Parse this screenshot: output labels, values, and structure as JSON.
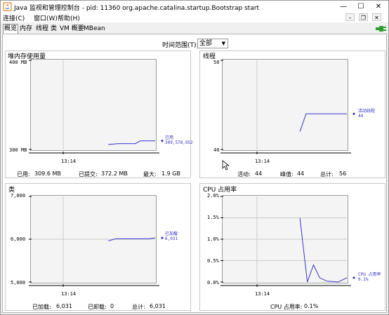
{
  "window": {
    "title": "Java 监视和管理控制台 - pid: 11360 org.apache.catalina.startup.Bootstrap start",
    "minimize": "—",
    "maximize": "☐",
    "close": "✕"
  },
  "menu": {
    "items": [
      "连接(C)",
      "窗口(W)",
      "帮助(H)"
    ]
  },
  "mdi_controls": [
    "–",
    "❐",
    "✕"
  ],
  "tabs": [
    "概览",
    "内存",
    "线程",
    "类",
    "VM 概要",
    "MBean"
  ],
  "time_range": {
    "label": "时间范围(T):",
    "value": "全部"
  },
  "colors": {
    "series": "#3333cc",
    "grid": "#cccccc",
    "connect_icon": "#2e9e2e"
  },
  "panels": {
    "heap": {
      "title": "堆内存使用量",
      "stats": [
        {
          "label": "已用:",
          "value": "309.6 MB"
        },
        {
          "label": "已提交:",
          "value": "372.2 MB"
        },
        {
          "label": "最大:",
          "value": "1.9 GB"
        }
      ]
    },
    "threads": {
      "title": "线程",
      "stats": [
        {
          "label": "活动:",
          "value": "44"
        },
        {
          "label": "峰值:",
          "value": "44"
        },
        {
          "label": "总计:",
          "value": "56"
        }
      ]
    },
    "classes": {
      "title": "类",
      "stats": [
        {
          "label": "已加载:",
          "value": "6,031"
        },
        {
          "label": "已卸载:",
          "value": "0"
        },
        {
          "label": "总计:",
          "value": "6,031"
        }
      ]
    },
    "cpu": {
      "title": "CPU 占用率",
      "stats": [
        {
          "label": "CPU 占用率:",
          "value": "0.1%"
        }
      ]
    }
  },
  "chart_data": [
    {
      "id": "heap",
      "type": "line",
      "ylim": [
        300,
        400
      ],
      "yticks": [
        "400 MB",
        "300 MB"
      ],
      "xticks": [
        "13:14"
      ],
      "x": [
        0.62,
        0.7,
        0.84,
        0.88,
        1.0
      ],
      "series": [
        {
          "name": "已用",
          "values": [
            305.5,
            306.5,
            306.5,
            309.6,
            309.6
          ],
          "latest": "309,578,952"
        }
      ]
    },
    {
      "id": "threads",
      "type": "line",
      "ylim": [
        40,
        50
      ],
      "yticks": [
        "50",
        "40"
      ],
      "xticks": [
        "13:14"
      ],
      "x": [
        0.62,
        0.67,
        1.0
      ],
      "series": [
        {
          "name": "活动线程",
          "values": [
            42,
            44,
            44
          ],
          "latest": "44"
        }
      ]
    },
    {
      "id": "classes",
      "type": "line",
      "ylim": [
        5000,
        7000
      ],
      "yticks": [
        "7,000",
        "6,000",
        "5,000"
      ],
      "xticks": [
        "13:14"
      ],
      "x": [
        0.62,
        0.68,
        0.95,
        1.0
      ],
      "series": [
        {
          "name": "已加载",
          "values": [
            5960,
            6010,
            6010,
            6031
          ],
          "latest": "6,031"
        }
      ]
    },
    {
      "id": "cpu",
      "type": "line",
      "ylim": [
        0,
        2.0
      ],
      "yticks": [
        "2.0%",
        "1.5%",
        "1.0%",
        "0.5%",
        "0.0%"
      ],
      "xticks": [
        "13:14"
      ],
      "x": [
        0.62,
        0.68,
        0.73,
        0.78,
        0.84,
        0.93,
        1.0
      ],
      "series": [
        {
          "name": "CPU 占用率",
          "values": [
            1.5,
            0.0,
            0.4,
            0.1,
            0.02,
            0.0,
            0.1
          ],
          "latest": "0.1%"
        }
      ]
    }
  ]
}
